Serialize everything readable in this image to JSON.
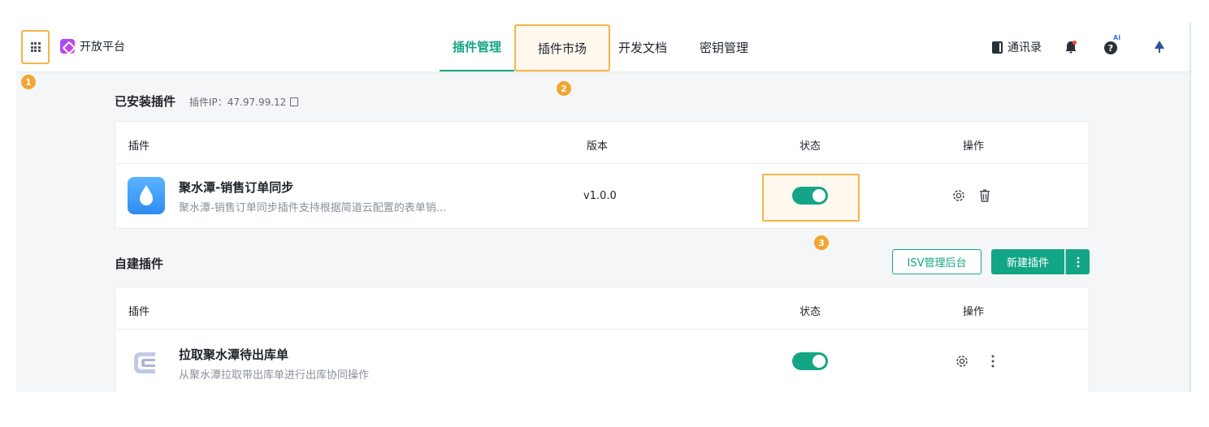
{
  "app": {
    "brand_name": "开放平台",
    "colors": {
      "accent": "#14a586",
      "highlight": "#f3b54a"
    }
  },
  "nav": {
    "tabs": [
      {
        "label": "插件管理",
        "active": true
      },
      {
        "label": "插件市场",
        "active": false,
        "highlighted": true
      },
      {
        "label": "开发文档",
        "active": false
      },
      {
        "label": "密钥管理",
        "active": false
      }
    ]
  },
  "tools": {
    "contacts_label": "通讯录",
    "ai_badge": "AI",
    "icons": [
      "book-icon",
      "bell-icon",
      "help-icon",
      "tree-icon"
    ]
  },
  "callouts": [
    "1",
    "2",
    "3"
  ],
  "installed": {
    "title": "已安装插件",
    "ip_label": "插件IP：47.97.99.12",
    "columns": {
      "plugin": "插件",
      "version": "版本",
      "status": "状态",
      "actions": "操作"
    },
    "rows": [
      {
        "name": "聚水潭-销售订单同步",
        "desc": "聚水潭-销售订单同步插件支持根据简道云配置的表单销...",
        "version": "v1.0.0",
        "enabled": true,
        "icon": "water-drop-icon"
      }
    ]
  },
  "custom": {
    "title": "自建插件",
    "isv_button": "ISV管理后台",
    "new_button": "新建插件",
    "columns": {
      "plugin": "插件",
      "status": "状态",
      "actions": "操作"
    },
    "rows": [
      {
        "name": "拉取聚水潭待出库单",
        "desc": "从聚水潭拉取带出库单进行出库协同操作",
        "enabled": true,
        "icon": "c-logo-icon"
      }
    ]
  }
}
